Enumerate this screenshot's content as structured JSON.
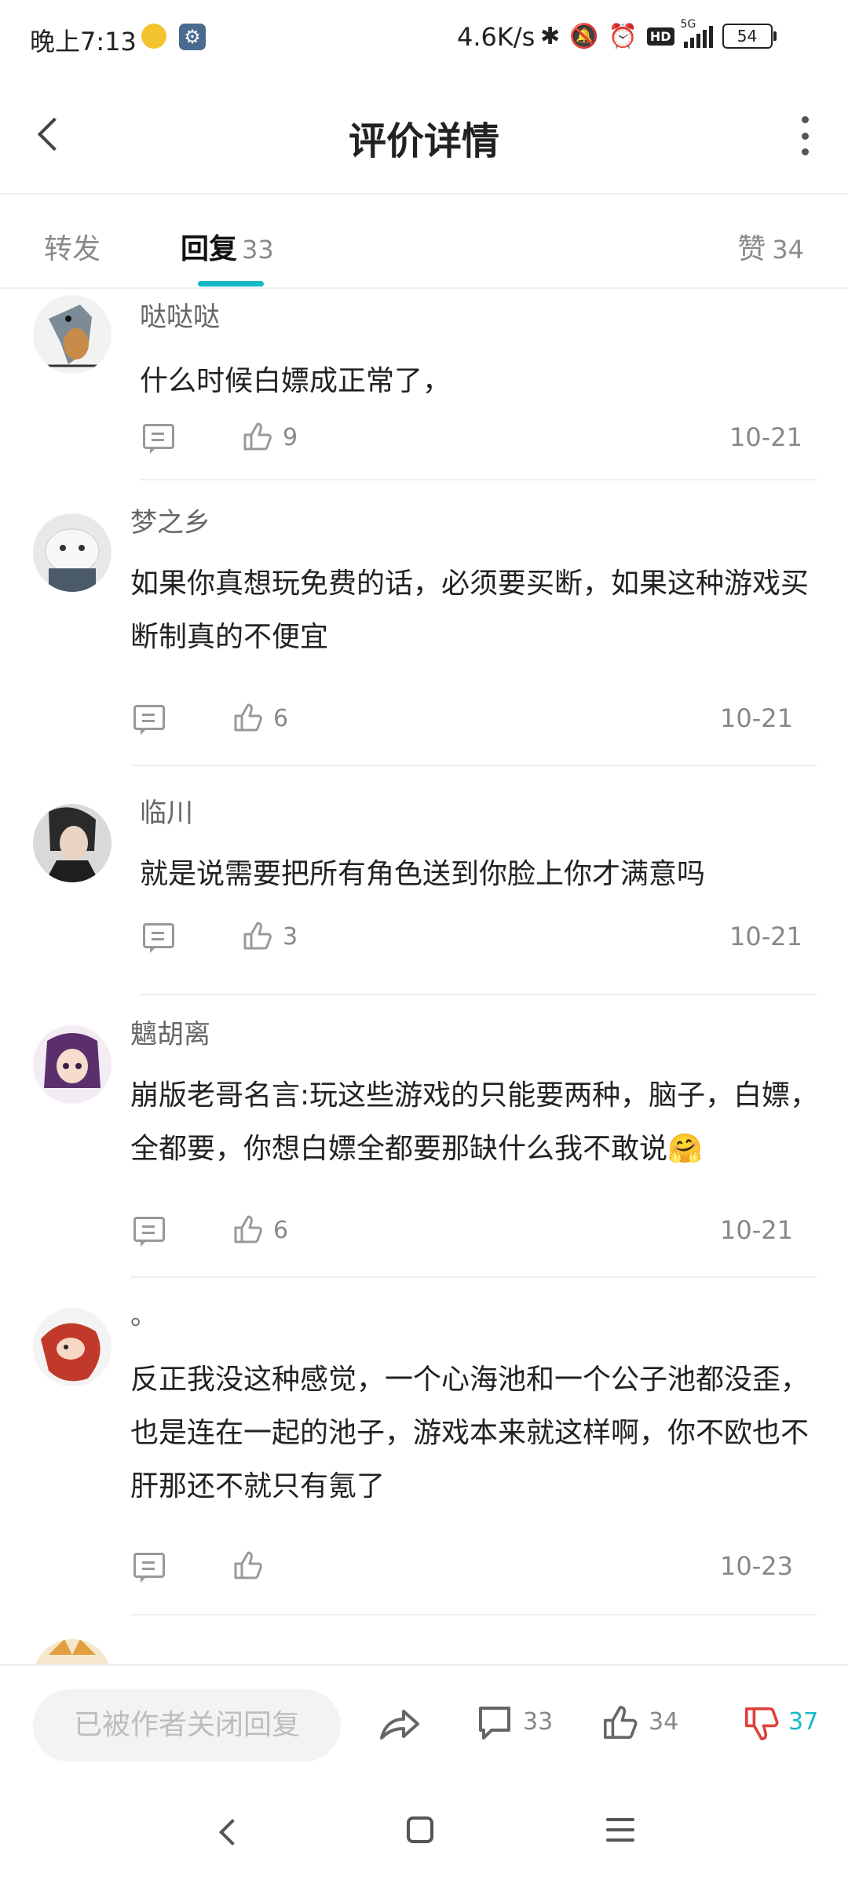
{
  "status_bar": {
    "time": "晚上7:13",
    "net_speed": "4.6K/s",
    "network": "5G",
    "hd": "HD",
    "battery": "54"
  },
  "header": {
    "title": "评价详情"
  },
  "tabs": {
    "forward_label": "转发",
    "replies_label": "回复",
    "replies_count": "33",
    "likes_label": "赞",
    "likes_count": "34"
  },
  "comments": [
    {
      "name": "哒哒哒",
      "text": "什么时候白嫖成正常了，",
      "likes": "9",
      "date": "10-21"
    },
    {
      "name": "梦之乡",
      "text": "如果你真想玩免费的话，必须要买断，如果这种游戏买断制真的不便宜",
      "likes": "6",
      "date": "10-21"
    },
    {
      "name": "临川",
      "text": "就是说需要把所有角色送到你脸上你才满意吗",
      "likes": "3",
      "date": "10-21"
    },
    {
      "name": "魑胡离",
      "text": "崩版老哥名言:玩这些游戏的只能要两种，脑子，白嫖，全都要，你想白嫖全都要那缺什么我不敢说🤗",
      "likes": "6",
      "date": "10-21"
    },
    {
      "name": "。",
      "text": "反正我没这种感觉，一个心海池和一个公子池都没歪，也是连在一起的池子，游戏本来就这样啊，你不欧也不肝那还不就只有氪了",
      "likes": "",
      "date": "10-23"
    }
  ],
  "bottom_bar": {
    "closed_placeholder": "已被作者关闭回复",
    "reply_count": "33",
    "like_count": "34",
    "dislike_count": "37",
    "dislike_color": "#e0403a",
    "accent_color": "#14b9c8"
  }
}
